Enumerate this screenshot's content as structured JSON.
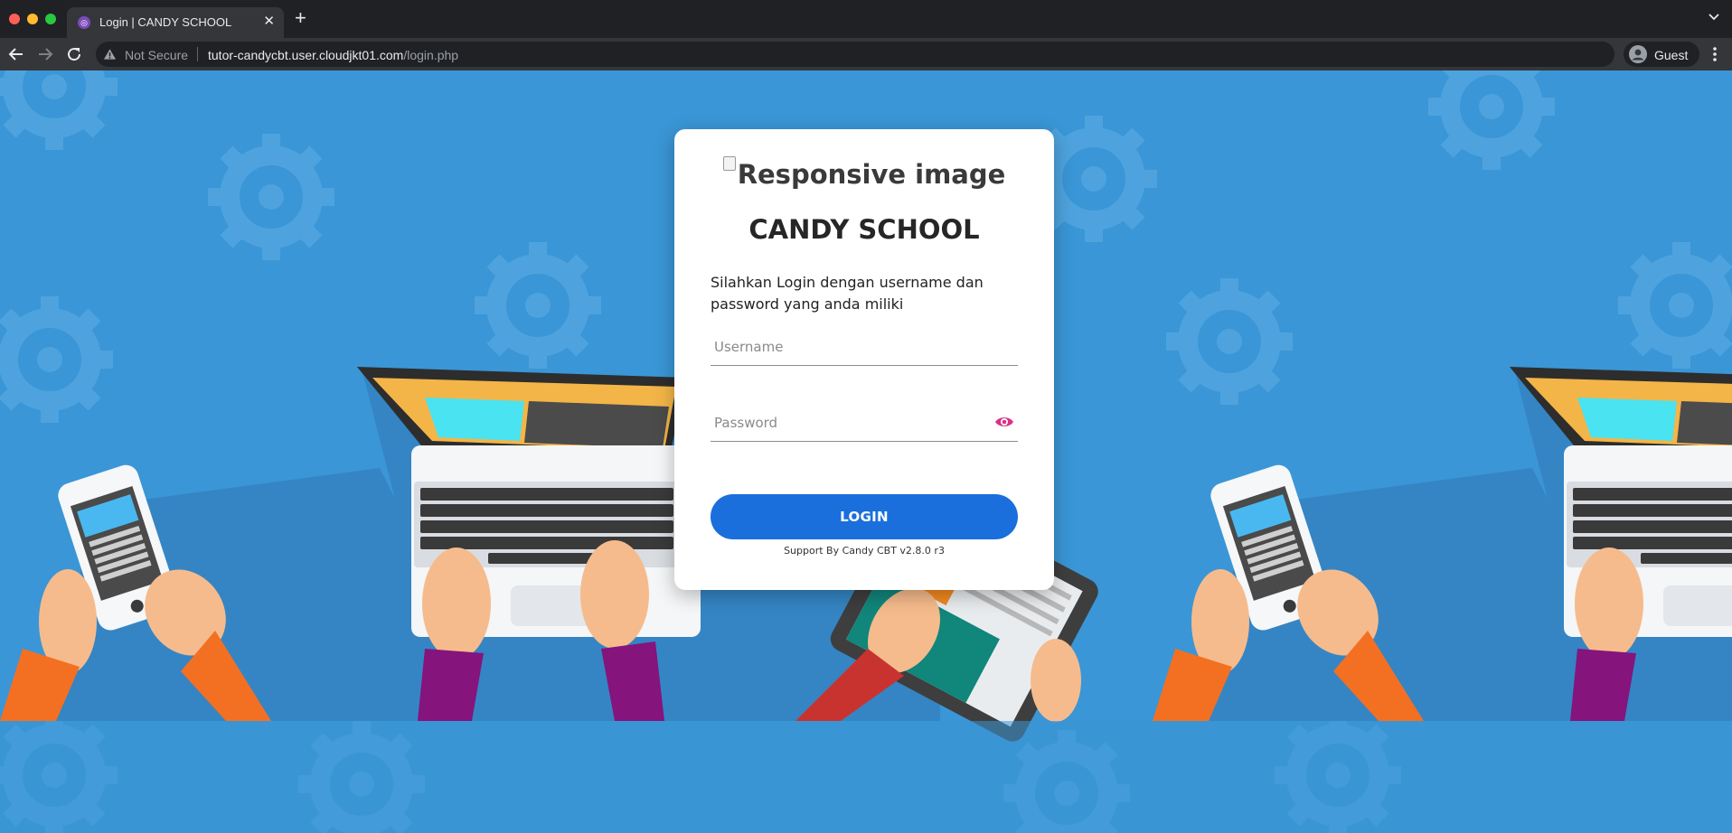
{
  "browser": {
    "tab": {
      "title": "Login | CANDY SCHOOL",
      "favicon": "candy-cbt-favicon"
    },
    "address_bar": {
      "security_label": "Not Secure",
      "host": "tutor-candycbt.user.cloudjkt01.com",
      "path": "/login.php"
    },
    "profile": {
      "label": "Guest"
    }
  },
  "login": {
    "logo_alt": "Responsive image",
    "school_name": "CANDY SCHOOL",
    "intro_text": "Silahkan Login dengan username dan password yang anda miliki",
    "username_placeholder": "Username",
    "password_placeholder": "Password",
    "login_label": "LOGIN",
    "support_text": "Support By Candy CBT v2.8.0 r3"
  },
  "colors": {
    "page_background": "#3a96d6",
    "login_button": "#1a6fdc",
    "eye_icon": "#d63384",
    "card": "#ffffff"
  }
}
